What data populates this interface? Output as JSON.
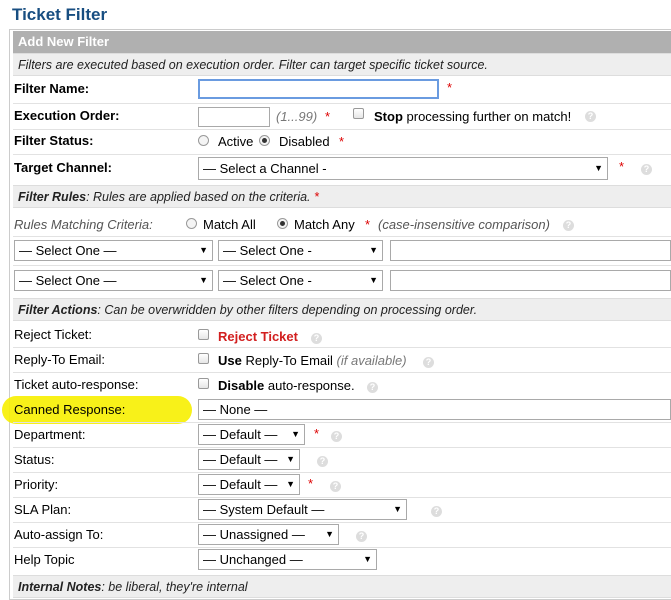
{
  "page_title": "Ticket Filter",
  "header": "Add New Filter",
  "intro": "Filters are executed based on execution order. Filter can target specific ticket source.",
  "fields": {
    "filter_name": {
      "label": "Filter Name:",
      "value": ""
    },
    "execution_order": {
      "label": "Execution Order:",
      "hint": "(1...99)",
      "stop_bold": "Stop",
      "stop_rest": "processing further on match!"
    },
    "filter_status": {
      "label": "Filter Status:",
      "active": "Active",
      "disabled": "Disabled",
      "selected": "Disabled"
    },
    "target_channel": {
      "label": "Target Channel:",
      "value": "— Select a Channel -"
    }
  },
  "rules_section": {
    "title": "Filter Rules",
    "desc": ": Rules are applied based on the criteria."
  },
  "rules": {
    "criteria_label": "Rules Matching Criteria:",
    "match_all": "Match All",
    "match_any": "Match Any",
    "selected": "Match Any",
    "note": "(case-insensitive comparison)",
    "row1": {
      "field": "— Select One —",
      "op": "— Select One -"
    },
    "row2": {
      "field": "— Select One —",
      "op": "— Select One -"
    }
  },
  "actions_section": {
    "title": "Filter Actions",
    "desc": ": Can be overwridden by other filters depending on processing order."
  },
  "actions": {
    "reject": {
      "label": "Reject Ticket:",
      "text": "Reject Ticket"
    },
    "reply_to": {
      "label": "Reply-To Email:",
      "bold": "Use",
      "rest": "Reply-To Email",
      "extra": "(if available)"
    },
    "auto_resp": {
      "label": "Ticket auto-response:",
      "bold": "Disable",
      "rest": "auto-response."
    },
    "canned": {
      "label": "Canned Response:",
      "value": "— None —"
    },
    "department": {
      "label": "Department:",
      "value": "— Default —"
    },
    "status": {
      "label": "Status:",
      "value": "— Default —"
    },
    "priority": {
      "label": "Priority:",
      "value": "— Default —"
    },
    "sla": {
      "label": "SLA Plan:",
      "value": "— System Default —"
    },
    "assign": {
      "label": "Auto-assign To:",
      "value": "— Unassigned —"
    },
    "topic": {
      "label": "Help Topic",
      "value": "— Unchanged —"
    }
  },
  "notes_section": {
    "title": "Internal Notes",
    "desc": ": be liberal, they're internal"
  },
  "glyphs": {
    "required": "*",
    "arrow": "▼",
    "help": "?"
  },
  "colors": {
    "title": "#184E81",
    "header_bg": "#b0b0b0",
    "section_bg": "#eeeeee",
    "reject": "#d21f1f",
    "highlight": "#f7f000"
  }
}
